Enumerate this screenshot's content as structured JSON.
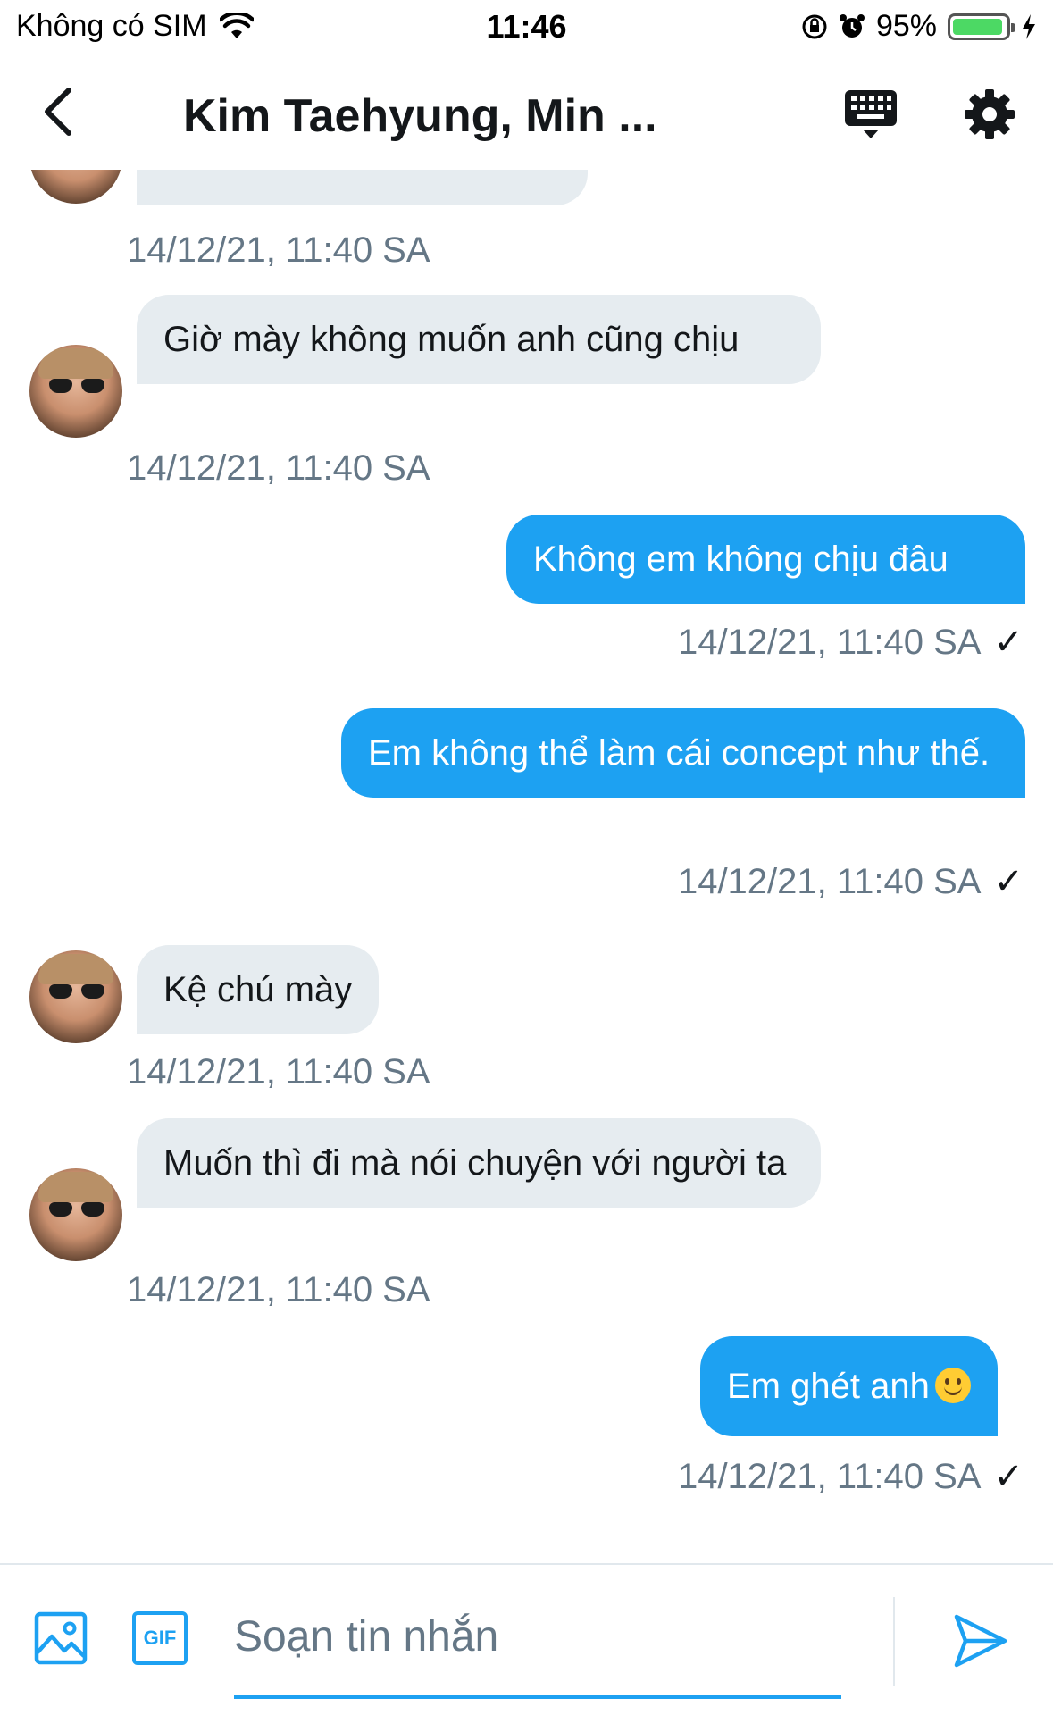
{
  "status_bar": {
    "carrier": "Không có SIM",
    "time": "11:46",
    "battery": "95%",
    "battery_level": 0.95
  },
  "header": {
    "title": "Kim Taehyung, Min ..."
  },
  "messages": [
    {
      "direction": "in",
      "text": "",
      "timestamp": "14/12/21, 11:40 SA"
    },
    {
      "direction": "in",
      "text": "Giờ mày không muốn anh cũng chịu",
      "timestamp": "14/12/21, 11:40 SA"
    },
    {
      "direction": "out",
      "text": "Không em không chịu đâu",
      "timestamp": "14/12/21, 11:40 SA",
      "status": "✓"
    },
    {
      "direction": "out",
      "text": "Em không thể làm cái concept như thế.",
      "timestamp": "14/12/21, 11:40 SA",
      "status": "✓"
    },
    {
      "direction": "in",
      "text": "Kệ chú mày",
      "timestamp": "14/12/21, 11:40 SA"
    },
    {
      "direction": "in",
      "text": "Muốn thì đi mà nói chuyện với người ta",
      "timestamp": "14/12/21, 11:40 SA"
    },
    {
      "direction": "out",
      "text": "Em ghét anh",
      "emoji": "slightly-smiling-face",
      "timestamp": "14/12/21, 11:40 SA",
      "status": "✓"
    }
  ],
  "composer": {
    "placeholder": "Soạn tin nhắn",
    "gif_label": "GIF"
  },
  "colors": {
    "accent": "#1da1f2",
    "incoming_bubble": "#e6ecf0",
    "timestamp": "#657786"
  },
  "icons": {
    "back": "chevron-left-icon",
    "keyboard": "keyboard-icon",
    "settings": "gear-icon",
    "image": "image-icon",
    "send": "send-icon"
  }
}
